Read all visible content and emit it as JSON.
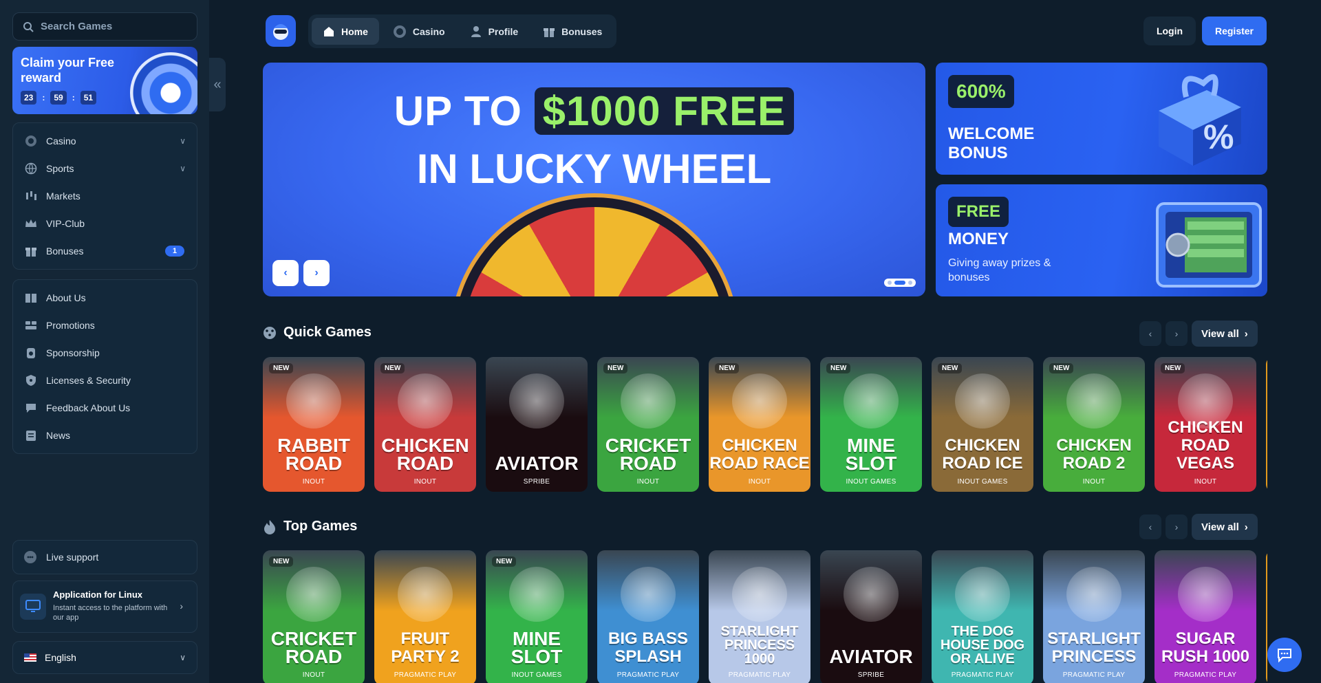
{
  "search": {
    "placeholder": "Search Games"
  },
  "promo": {
    "title": "Claim your Free reward",
    "timer": [
      "23",
      "59",
      "51"
    ]
  },
  "sidebar": {
    "primary": [
      {
        "label": "Casino",
        "icon": "casino-chip-icon",
        "expandable": true
      },
      {
        "label": "Sports",
        "icon": "globe-ball-icon",
        "expandable": true
      },
      {
        "label": "Markets",
        "icon": "candlestick-icon"
      },
      {
        "label": "VIP-Club",
        "icon": "crown-icon"
      },
      {
        "label": "Bonuses",
        "icon": "gift-icon",
        "badge": "1"
      }
    ],
    "secondary": [
      {
        "label": "About Us",
        "icon": "book-icon"
      },
      {
        "label": "Promotions",
        "icon": "ticket-icon"
      },
      {
        "label": "Sponsorship",
        "icon": "medal-icon"
      },
      {
        "label": "Licenses & Security",
        "icon": "shield-icon"
      },
      {
        "label": "Feedback About Us",
        "icon": "chat-bubble-icon"
      },
      {
        "label": "News",
        "icon": "newspaper-icon"
      }
    ],
    "live_support": "Live support",
    "app": {
      "title": "Application for Linux",
      "subtitle": "Instant access to the platform with our app"
    },
    "language": "English"
  },
  "topnav": {
    "tabs": [
      {
        "label": "Home",
        "icon": "home-icon",
        "active": true
      },
      {
        "label": "Casino",
        "icon": "chip-icon"
      },
      {
        "label": "Profile",
        "icon": "user-icon"
      },
      {
        "label": "Bonuses",
        "icon": "gift-icon"
      }
    ],
    "login": "Login",
    "register": "Register"
  },
  "hero": {
    "line1_pre": "UP TO",
    "line1_highlight": "$1000 FREE",
    "line2": "IN LUCKY WHEEL",
    "slides": 3,
    "active_slide": 2
  },
  "banners": [
    {
      "chip": "600%",
      "title": "WELCOME BONUS"
    },
    {
      "chip": "FREE",
      "title": "MONEY",
      "subtitle": "Giving away prizes & bonuses"
    }
  ],
  "sections": {
    "quick": {
      "title": "Quick Games",
      "view_all": "View all",
      "games": [
        {
          "name": "RABBIT ROAD",
          "provider": "INOUT",
          "is_new": true,
          "bg": "#e5572e"
        },
        {
          "name": "CHICKEN ROAD",
          "provider": "INOUT",
          "is_new": true,
          "bg": "#c83a3a"
        },
        {
          "name": "AVIATOR",
          "provider": "SPRIBE",
          "is_new": false,
          "bg": "#1a0c10"
        },
        {
          "name": "CRICKET ROAD",
          "provider": "INOUT",
          "is_new": true,
          "bg": "#3ba540"
        },
        {
          "name": "CHICKEN ROAD RACE",
          "provider": "INOUT",
          "is_new": true,
          "bg": "#e9962a"
        },
        {
          "name": "MINE SLOT",
          "provider": "INOUT GAMES",
          "is_new": true,
          "bg": "#33b34a"
        },
        {
          "name": "CHICKEN ROAD ICE",
          "provider": "INOUT GAMES",
          "is_new": true,
          "bg": "#8a6a38"
        },
        {
          "name": "CHICKEN ROAD 2",
          "provider": "INOUT",
          "is_new": true,
          "bg": "#48ad3c"
        },
        {
          "name": "CHICKEN ROAD VEGAS",
          "provider": "INOUT",
          "is_new": true,
          "bg": "#c6283b"
        }
      ]
    },
    "top": {
      "title": "Top Games",
      "view_all": "View all",
      "games": [
        {
          "name": "CRICKET ROAD",
          "provider": "INOUT",
          "is_new": true,
          "bg": "#3ba540"
        },
        {
          "name": "FRUIT PARTY 2",
          "provider": "PRAGMATIC PLAY",
          "is_new": false,
          "bg": "#f0a21e"
        },
        {
          "name": "MINE SLOT",
          "provider": "INOUT GAMES",
          "is_new": true,
          "bg": "#33b34a"
        },
        {
          "name": "BIG BASS SPLASH",
          "provider": "PRAGMATIC PLAY",
          "is_new": false,
          "bg": "#3f8fd2"
        },
        {
          "name": "STARLIGHT PRINCESS 1000",
          "provider": "PRAGMATIC PLAY",
          "is_new": false,
          "bg": "#b7c8e8"
        },
        {
          "name": "AVIATOR",
          "provider": "SPRIBE",
          "is_new": false,
          "bg": "#1a0c10"
        },
        {
          "name": "THE DOG HOUSE DOG OR ALIVE",
          "provider": "PRAGMATIC PLAY",
          "is_new": false,
          "bg": "#3fb6b0"
        },
        {
          "name": "STARLIGHT PRINCESS",
          "provider": "PRAGMATIC PLAY",
          "is_new": false,
          "bg": "#7aa4de"
        },
        {
          "name": "SUGAR RUSH 1000",
          "provider": "PRAGMATIC PLAY",
          "is_new": false,
          "bg": "#a42ec8"
        }
      ]
    }
  },
  "colors": {
    "accent": "#2f6cf1",
    "background": "#0e1d2b",
    "sidebar": "#142636"
  }
}
